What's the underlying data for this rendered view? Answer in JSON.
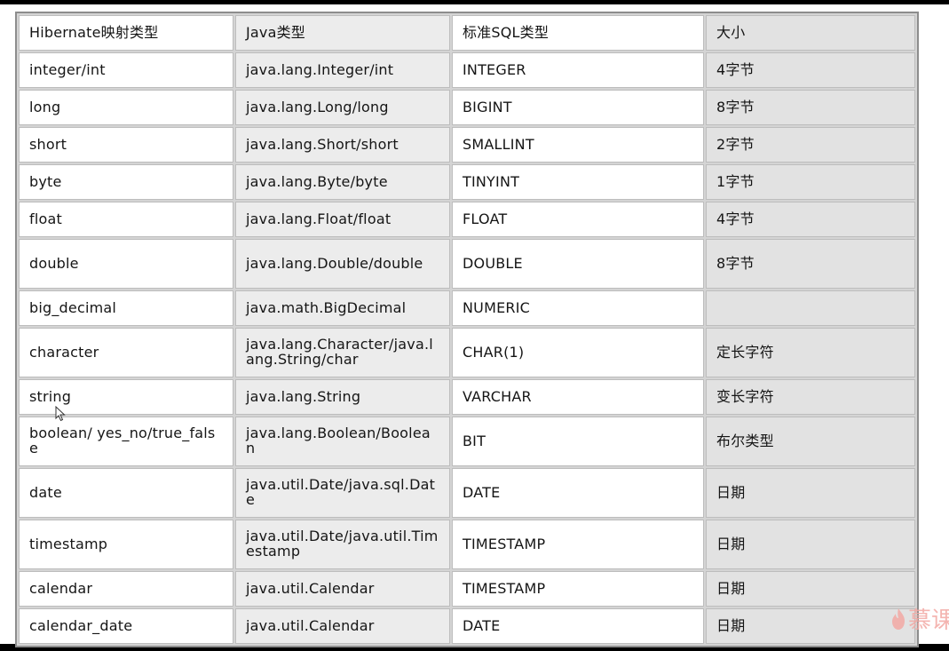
{
  "table": {
    "headers": [
      "Hibernate映射类型",
      "Java类型",
      "标准SQL类型",
      "大小"
    ],
    "rows": [
      {
        "mapping": "integer/int",
        "java": "java.lang.Integer/int",
        "sql": "INTEGER",
        "size": "4字节"
      },
      {
        "mapping": "long",
        "java": "java.lang.Long/long",
        "sql": "BIGINT",
        "size": "8字节"
      },
      {
        "mapping": "short",
        "java": "java.lang.Short/short",
        "sql": "SMALLINT",
        "size": "2字节"
      },
      {
        "mapping": "byte",
        "java": "java.lang.Byte/byte",
        "sql": "TINYINT",
        "size": "1字节"
      },
      {
        "mapping": "float",
        "java": "java.lang.Float/float",
        "sql": "FLOAT",
        "size": "4字节"
      },
      {
        "mapping": "double",
        "java": "java.lang.Double/double",
        "sql": "DOUBLE",
        "size": "8字节"
      },
      {
        "mapping": "big_decimal",
        "java": "java.math.BigDecimal",
        "sql": "NUMERIC",
        "size": ""
      },
      {
        "mapping": "character",
        "java": "java.lang.Character/java.lang.String/char",
        "sql": "CHAR(1)",
        "size": "定长字符"
      },
      {
        "mapping": "string",
        "java": "java.lang.String",
        "sql": "VARCHAR",
        "size": "变长字符"
      },
      {
        "mapping": "boolean/ yes_no/true_false",
        "java": "java.lang.Boolean/Boolean",
        "sql": "BIT",
        "size": "布尔类型"
      },
      {
        "mapping": "date",
        "java": "java.util.Date/java.sql.Date",
        "sql": "DATE",
        "size": "日期"
      },
      {
        "mapping": "timestamp",
        "java": "java.util.Date/java.util.Timestamp",
        "sql": "TIMESTAMP",
        "size": "日期"
      },
      {
        "mapping": "calendar",
        "java": "java.util.Calendar",
        "sql": "TIMESTAMP",
        "size": "日期"
      },
      {
        "mapping": "calendar_date",
        "java": "java.util.Calendar",
        "sql": "DATE",
        "size": "日期"
      }
    ]
  },
  "watermark": {
    "text": "慕课",
    "icon": "flame-logo-icon",
    "color": "#f3a9a4"
  },
  "cursor": {
    "icon": "mouse-pointer-icon"
  }
}
